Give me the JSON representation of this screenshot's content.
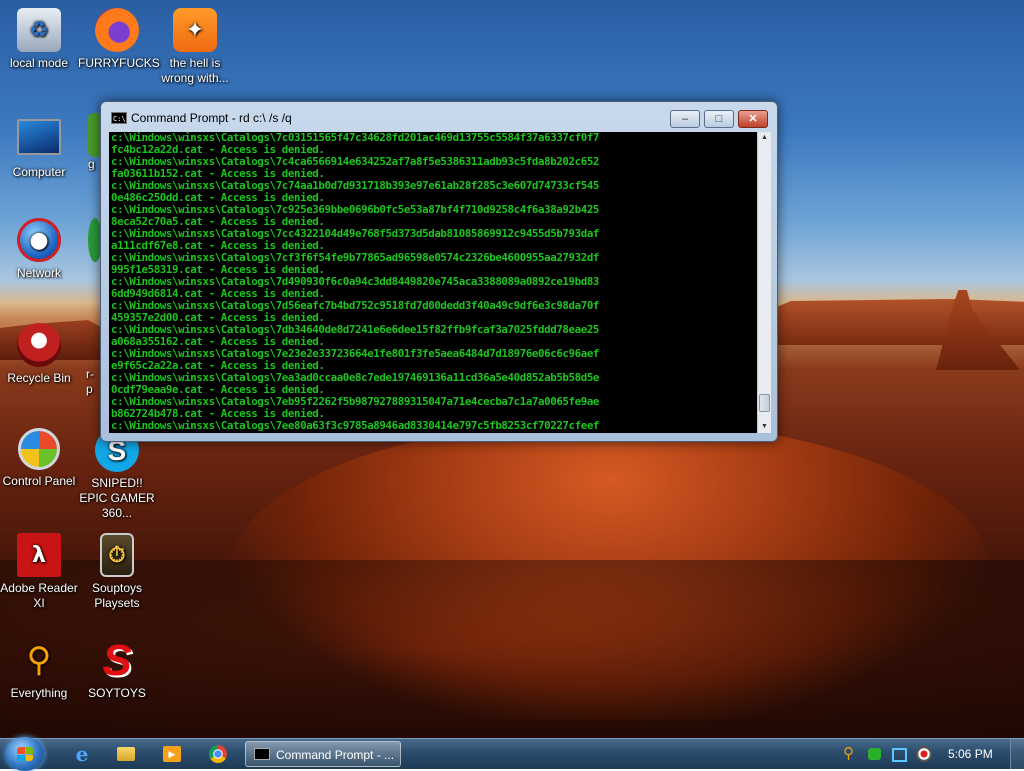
{
  "desktop_icons": [
    {
      "label": "local mode",
      "icon": "recycle-bin-full-icon"
    },
    {
      "label": "FURRYFUCKS",
      "icon": "firefox-icon"
    },
    {
      "label": "the hell is wrong with...",
      "icon": "uc-browser-icon"
    },
    {
      "label": "Computer",
      "icon": "computer-icon"
    },
    {
      "label": "Network",
      "icon": "network-icon"
    },
    {
      "label": "Recycle Bin",
      "icon": "recycle-bin-icon"
    },
    {
      "label": "Control Panel",
      "icon": "control-panel-icon"
    },
    {
      "label": "SNIPED!! EPIC GAMER 360...",
      "icon": "skype-icon"
    },
    {
      "label": "Adobe Reader XI",
      "icon": "adobe-reader-icon"
    },
    {
      "label": "Souptoys Playsets",
      "icon": "souptoys-icon"
    },
    {
      "label": "Everything",
      "icon": "everything-search-icon"
    },
    {
      "label": "SOYTOYS",
      "icon": "soytoys-icon"
    }
  ],
  "partial_icon_labels": [
    "g",
    "r-",
    "p"
  ],
  "cmd_window": {
    "title": "Command Prompt - rd  c:\\ /s /q",
    "minimize": "–",
    "maximize": "□",
    "close": "✕",
    "lines": [
      "c:\\Windows\\winsxs\\Catalogs\\7c03151565f47c34628fd201ac469d13755c5584f37a6337cf0f7",
      "fc4bc12a22d.cat - Access is denied.",
      "c:\\Windows\\winsxs\\Catalogs\\7c4ca6566914e634252af7a8f5e5386311adb93c5fda8b202c652",
      "fa03611b152.cat - Access is denied.",
      "c:\\Windows\\winsxs\\Catalogs\\7c74aa1b0d7d931718b393e97e61ab28f285c3e607d74733cf545",
      "0e486c250dd.cat - Access is denied.",
      "c:\\Windows\\winsxs\\Catalogs\\7c925e369bbe0696b0fc5e53a87bf4f710d9258c4f6a38a92b425",
      "8eca52c70a5.cat - Access is denied.",
      "c:\\Windows\\winsxs\\Catalogs\\7cc4322104d49e768f5d373d5dab81085869912c9455d5b793daf",
      "a111cdf67e8.cat - Access is denied.",
      "c:\\Windows\\winsxs\\Catalogs\\7cf3f6f54fe9b77865ad96598e0574c2326be4600955aa27932df",
      "995f1e58319.cat - Access is denied.",
      "c:\\Windows\\winsxs\\Catalogs\\7d490930f6c0a94c3dd8449820e745aca3388089a0892ce19bd83",
      "6dd949d6814.cat - Access is denied.",
      "c:\\Windows\\winsxs\\Catalogs\\7d56eafc7b4bd752c9518fd7d00dedd3f40a49c9df6e3c98da70f",
      "459357e2d00.cat - Access is denied.",
      "c:\\Windows\\winsxs\\Catalogs\\7db34640de8d7241e6e6dee15f82ffb9fcaf3a7025fddd78eae25",
      "a068a355162.cat - Access is denied.",
      "c:\\Windows\\winsxs\\Catalogs\\7e23e2e33723664e1fe801f3fe5aea6484d7d18976e06c6c96aef",
      "e9f65c2a22a.cat - Access is denied.",
      "c:\\Windows\\winsxs\\Catalogs\\7ea3ad0ccaa0e8c7ede197469136a11cd36a5e40d852ab5b58d5e",
      "0cdf79eaa9e.cat - Access is denied.",
      "c:\\Windows\\winsxs\\Catalogs\\7eb95f2262f5b987927889315047a71e4cecba7c1a7a0065fe9ae",
      "b862724b478.cat - Access is denied.",
      "c:\\Windows\\winsxs\\Catalogs\\7ee80a63f3c9785a8946ad8330414e797c5fb8253cf70227cfeef"
    ]
  },
  "taskbar": {
    "pinned": [
      "internet-explorer-icon",
      "file-explorer-icon",
      "media-player-icon",
      "chrome-icon"
    ],
    "task_label": "Command Prompt - ...",
    "tray": [
      "everything-tray-icon",
      "network-tray-icon",
      "action-center-icon",
      "volume-icon"
    ],
    "clock": "5:06 PM"
  },
  "colors": {
    "console_text": "#1ec41e",
    "console_bg": "#000000"
  }
}
